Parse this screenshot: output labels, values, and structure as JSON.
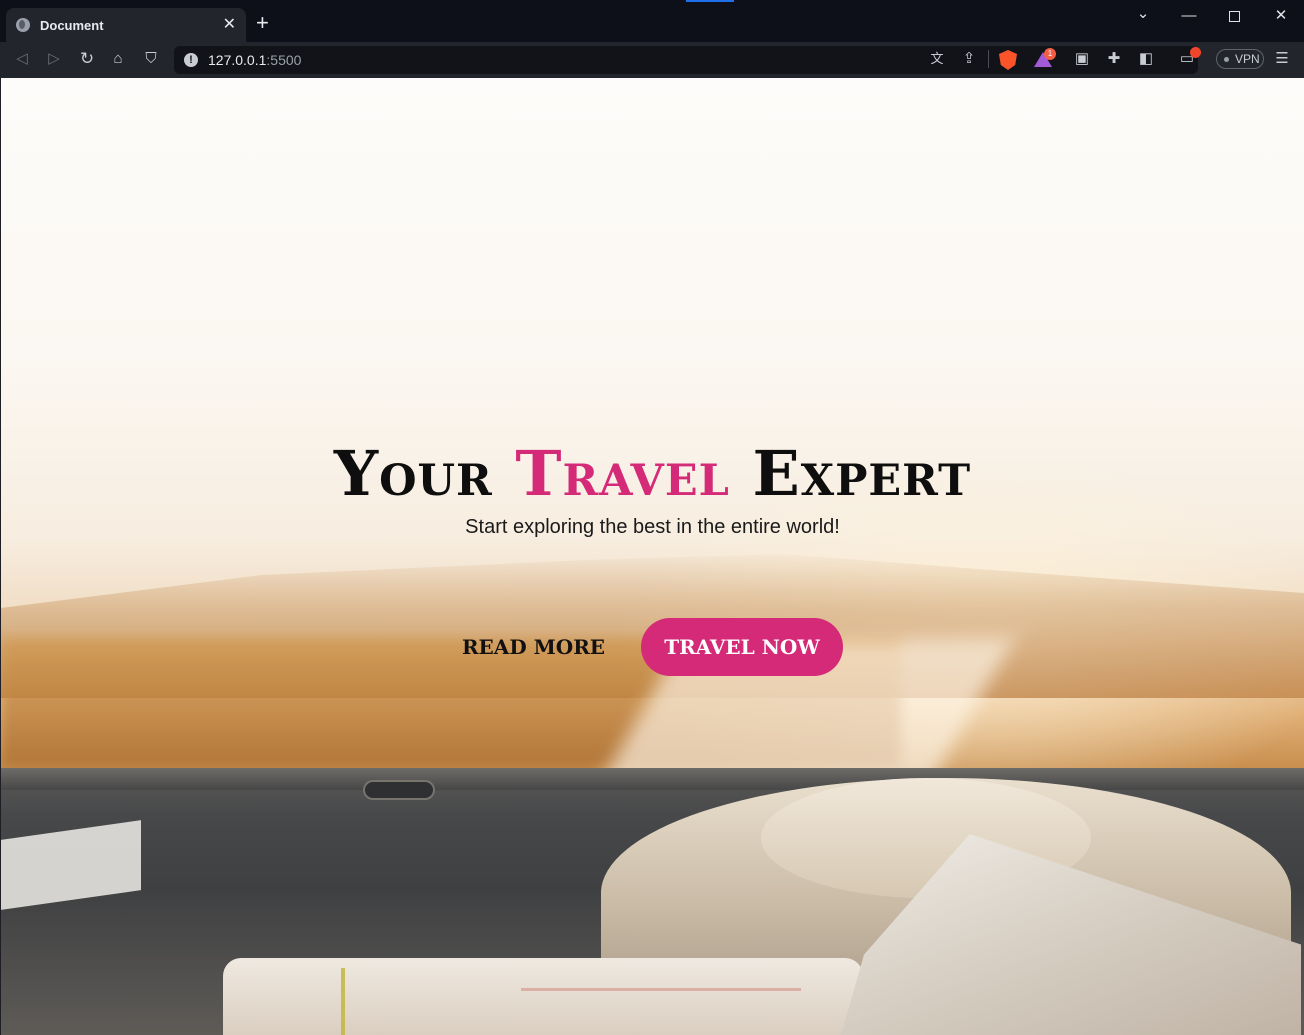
{
  "browser": {
    "tab_title": "Document",
    "tab_close": "✕",
    "new_tab": "+",
    "url_host": "127.0.0.1",
    "url_port": ":5500",
    "vpn_label": "VPN",
    "rewards_badge": "1",
    "window_controls": {
      "chevron": "⌄",
      "minimize": "—",
      "close": "✕"
    },
    "toolbar_icons": [
      "back-icon",
      "forward-icon",
      "reload-icon",
      "home-icon",
      "bookmark-icon",
      "translate-icon",
      "share-icon",
      "brave-shields-icon",
      "brave-rewards-icon",
      "picture-in-picture-icon",
      "extensions-icon",
      "sidebar-icon",
      "wallet-icon",
      "menu-icon"
    ]
  },
  "hero": {
    "title_part1": "Your ",
    "title_accent": "Travel",
    "title_part2": " Expert",
    "subtitle": "Start exploring the best in the entire world!",
    "read_more": "READ MORE",
    "travel_now": "TRAVEL NOW"
  },
  "colors": {
    "accent": "#d42a78",
    "chrome_dark": "#0d1018",
    "toolbar": "#23252d"
  }
}
